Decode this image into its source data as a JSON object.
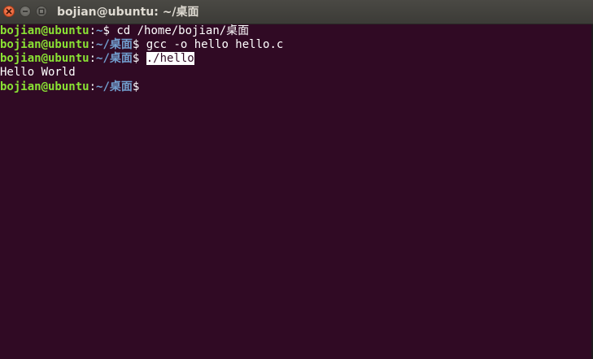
{
  "window": {
    "title": "bojian@ubuntu: ~/桌面",
    "buttons": {
      "close": "close-icon",
      "minimize": "minimize-icon",
      "maximize": "maximize-icon"
    }
  },
  "colors": {
    "terminal_bg": "#300a24",
    "user_host": "#8ae234",
    "path": "#729fcf",
    "text": "#ffffff"
  },
  "terminal": {
    "lines": [
      {
        "user": "bojian@ubuntu",
        "sep": ":",
        "path": "~",
        "prompt": "$ ",
        "command": "cd /home/bojian/桌面"
      },
      {
        "user": "bojian@ubuntu",
        "sep": ":",
        "path": "~/桌面",
        "prompt": "$ ",
        "command": "gcc -o hello hello.c"
      },
      {
        "user": "bojian@ubuntu",
        "sep": ":",
        "path": "~/桌面",
        "prompt": "$ ",
        "command": "./hello"
      },
      {
        "output": "Hello World"
      },
      {
        "user": "bojian@ubuntu",
        "sep": ":",
        "path": "~/桌面",
        "prompt": "$",
        "command": ""
      }
    ]
  }
}
